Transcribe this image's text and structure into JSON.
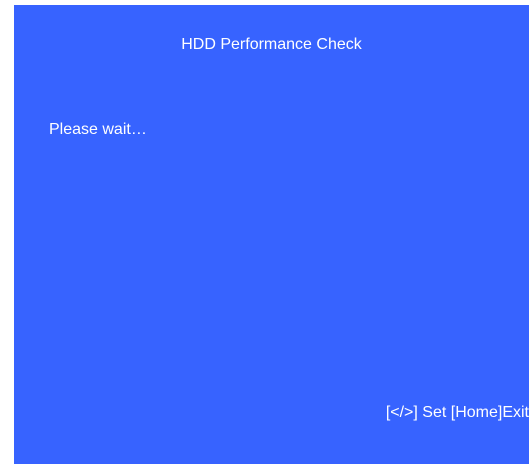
{
  "screen": {
    "title": "HDD Performance Check",
    "message": "Please wait…",
    "background_color": "#3763ff",
    "text_color": "#ffffff"
  },
  "footer": {
    "set_key": "[</>] Set",
    "exit_key": "[Home]Exit"
  }
}
